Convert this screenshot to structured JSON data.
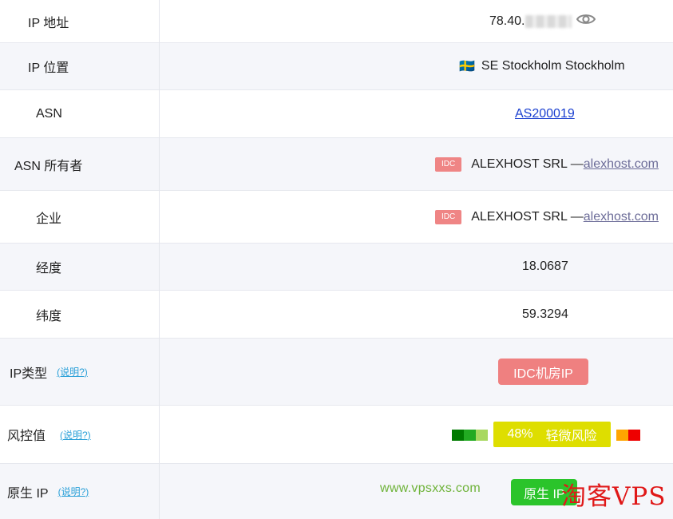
{
  "rows": {
    "ip_address": {
      "label": "IP 地址",
      "value_visible": "78.40."
    },
    "ip_location": {
      "label": "IP 位置",
      "flag": "🇸🇪",
      "value": "SE Stockholm Stockholm"
    },
    "asn": {
      "label": "ASN",
      "value": "AS200019"
    },
    "asn_owner": {
      "label": "ASN 所有者",
      "badge": "IDC",
      "company": "ALEXHOST SRL —",
      "domain": "alexhost.com"
    },
    "enterprise": {
      "label": "企业",
      "badge": "IDC",
      "company": "ALEXHOST SRL —",
      "domain": "alexhost.com"
    },
    "longitude": {
      "label": "经度",
      "value": "18.0687"
    },
    "latitude": {
      "label": "纬度",
      "value": "59.3294"
    },
    "ip_type": {
      "label": "IP类型",
      "help": "(说明?)",
      "value": "IDC机房IP"
    },
    "risk": {
      "label": "风控值",
      "help": "(说明?)",
      "percent": "48%",
      "level": "轻微风险"
    },
    "native_ip": {
      "label": "原生 IP",
      "help": "(说明?)",
      "value": "原生 IP"
    }
  },
  "watermarks": {
    "url": "www.vpsxxs.com",
    "brand": "淘客VPS"
  },
  "colors": {
    "idc_badge": "#ef8585",
    "idc_button": "#ef8080",
    "risk_badge": "#dede00",
    "native_button": "#2bc42b",
    "link": "#1a3fd0",
    "help_link": "#2aa0d8",
    "risk_green_dark": "#007a00",
    "risk_green": "#22aa22",
    "risk_green_light": "#a8d860",
    "risk_orange": "#ffa500",
    "risk_red": "#ee0000"
  }
}
